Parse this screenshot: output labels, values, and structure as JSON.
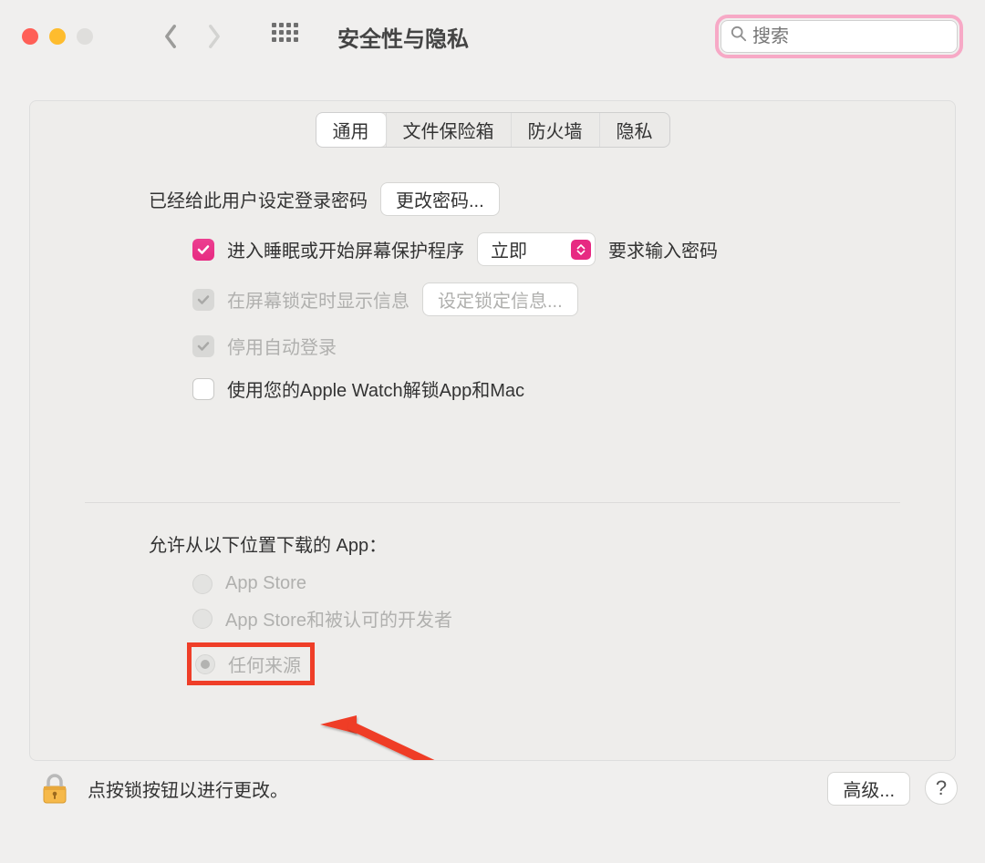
{
  "toolbar": {
    "window_title": "安全性与隐私",
    "search_placeholder": "搜索"
  },
  "tabs": {
    "general": "通用",
    "filevault": "文件保险箱",
    "firewall": "防火墙",
    "privacy": "隐私"
  },
  "upper": {
    "password_set_label": "已经给此用户设定登录密码",
    "change_password_btn": "更改密码...",
    "require_password_label": "进入睡眠或开始屏幕保护程序",
    "require_password_after": "要求输入密码",
    "delay_selected": "立即",
    "show_message_label": "在屏幕锁定时显示信息",
    "set_lock_message_btn": "设定锁定信息...",
    "disable_auto_login_label": "停用自动登录",
    "apple_watch_label": "使用您的Apple Watch解锁App和Mac"
  },
  "lower": {
    "allow_apps_heading": "允许从以下位置下载的 App：",
    "radio_app_store": "App Store",
    "radio_identified": "App Store和被认可的开发者",
    "radio_anywhere": "任何来源"
  },
  "footer": {
    "lock_hint": "点按锁按钮以进行更改。",
    "advanced_btn": "高级..."
  }
}
